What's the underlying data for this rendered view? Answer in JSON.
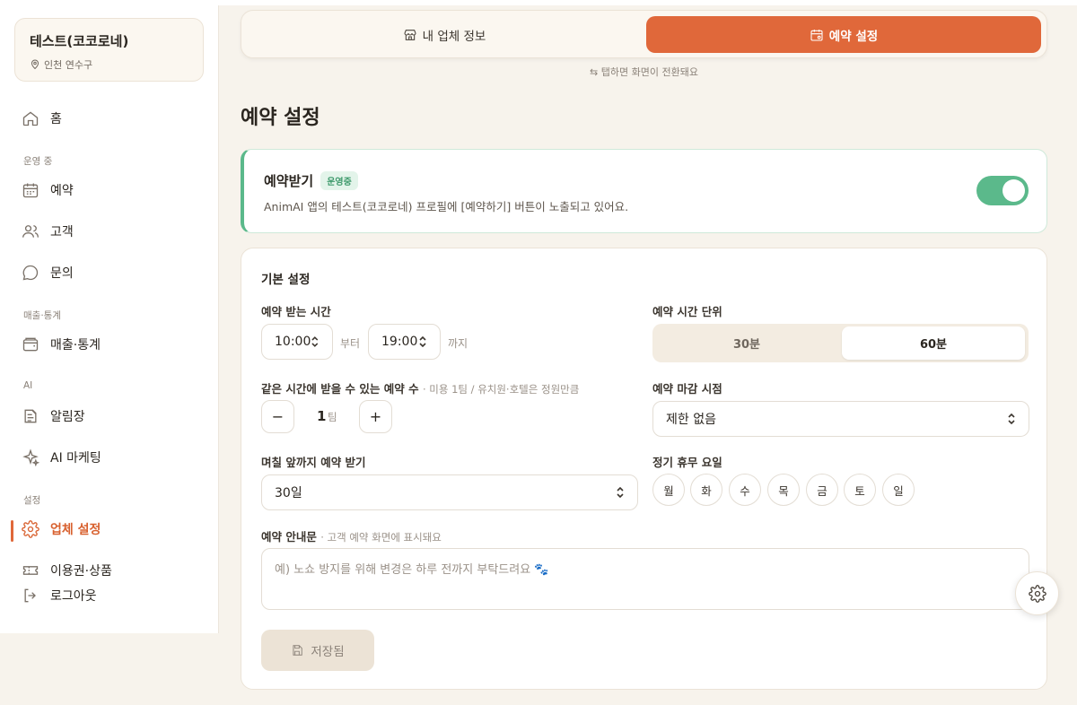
{
  "sidebar": {
    "business_name": "테스트(코코로네)",
    "business_location": "인천 연수구",
    "items": [
      {
        "label": "홈",
        "icon": "home-icon"
      },
      {
        "label": "예약",
        "icon": "calendar-icon"
      },
      {
        "label": "고객",
        "icon": "users-icon"
      },
      {
        "label": "문의",
        "icon": "chat-icon"
      },
      {
        "label": "매출·통계",
        "icon": "wallet-icon"
      },
      {
        "label": "알림장",
        "icon": "note-icon"
      },
      {
        "label": "AI 마케팅",
        "icon": "sparkle-icon"
      },
      {
        "label": "업체 설정",
        "icon": "gear-icon"
      },
      {
        "label": "이용권·상품",
        "icon": "ticket-icon"
      },
      {
        "label": "로그아웃",
        "icon": "logout-icon"
      }
    ],
    "sections": [
      "운영 중",
      "매출·통계",
      "AI",
      "설정"
    ],
    "active_item": "업체 설정"
  },
  "tabs": {
    "info_label": "내 업체 정보",
    "reserve_label": "예약 설정",
    "hint": "탭하면 화면이 전환돼요",
    "active": "예약 설정"
  },
  "page_title": "예약 설정",
  "accept": {
    "title": "예약받기",
    "badge": "운영중",
    "description": "AnimAI 앱의 테스트(코코로네) 프로필에 [예약하기] 버튼이 노출되고 있어요.",
    "enabled": true
  },
  "settings": {
    "section_title": "기본 설정",
    "hours": {
      "label": "예약 받는 시간",
      "start": "10:00",
      "from_text": "부터",
      "end": "19:00",
      "until_text": "까지"
    },
    "unit": {
      "label": "예약 시간 단위",
      "options": [
        "30분",
        "60분"
      ],
      "selected": "60분"
    },
    "capacity": {
      "label": "같은 시간에 받을 수 있는 예약 수",
      "sub": "· 미용 1팀 / 유치원·호텔은 정원만큼",
      "value": "1",
      "unit": "팀",
      "minus": "−",
      "plus": "+"
    },
    "deadline": {
      "label": "예약 마감 시점",
      "value": "제한 없음"
    },
    "advance": {
      "label": "며칠 앞까지 예약 받기",
      "value": "30일"
    },
    "holidays": {
      "label": "정기 휴무 요일",
      "days": [
        "월",
        "화",
        "수",
        "목",
        "금",
        "토",
        "일"
      ]
    },
    "notice": {
      "label": "예약 안내문",
      "sub": "· 고객 예약 화면에 표시돼요",
      "placeholder": "예) 노쇼 방지를 위해 변경은 하루 전까지 부탁드려요 🐾"
    },
    "save_label": "저장됨"
  },
  "colors": {
    "accent": "#e0683a",
    "success": "#5bb98b",
    "background": "#f7f3ec"
  }
}
